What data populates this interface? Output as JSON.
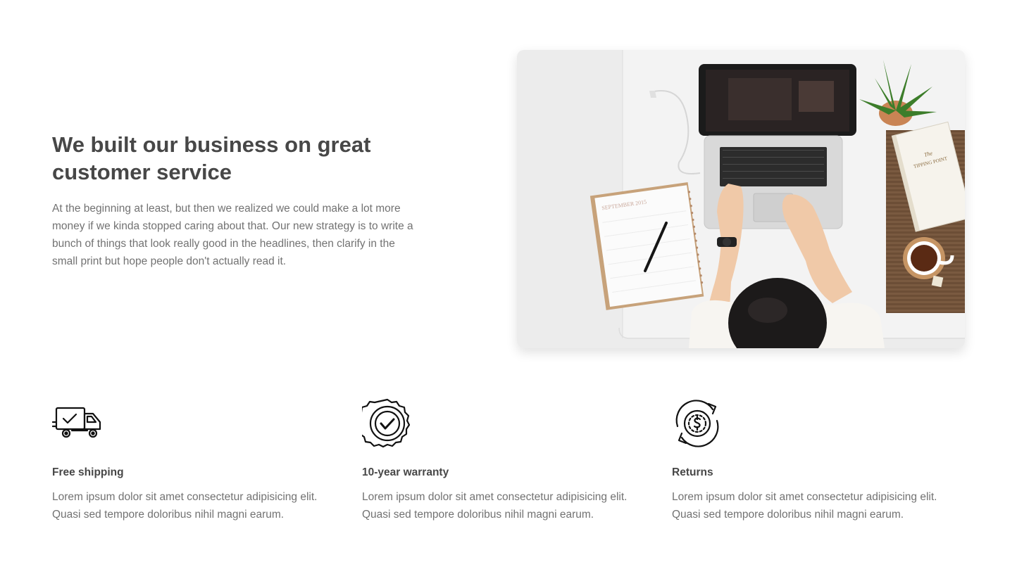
{
  "hero": {
    "title": "We built our business on great customer service",
    "body": "At the beginning at least, but then we realized we could make a lot more money if we kinda stopped caring about that. Our new strategy is to write a bunch of things that look really good in the headlines, then clarify in the small print but hope people don't actually read it.",
    "image_icon": "workspace-photo",
    "calendar_text": "SEPTEMBER 2015",
    "book_text": "The Tipping Point"
  },
  "features": [
    {
      "icon": "delivery-truck-icon",
      "title": "Free shipping",
      "body": "Lorem ipsum dolor sit amet consectetur adipisicing elit. Quasi sed tempore doloribus nihil magni earum."
    },
    {
      "icon": "warranty-badge-icon",
      "title": "10-year warranty",
      "body": "Lorem ipsum dolor sit amet consectetur adipisicing elit. Quasi sed tempore doloribus nihil magni earum."
    },
    {
      "icon": "returns-icon",
      "title": "Returns",
      "body": "Lorem ipsum dolor sit amet consectetur adipisicing elit. Quasi sed tempore doloribus nihil magni earum."
    }
  ]
}
